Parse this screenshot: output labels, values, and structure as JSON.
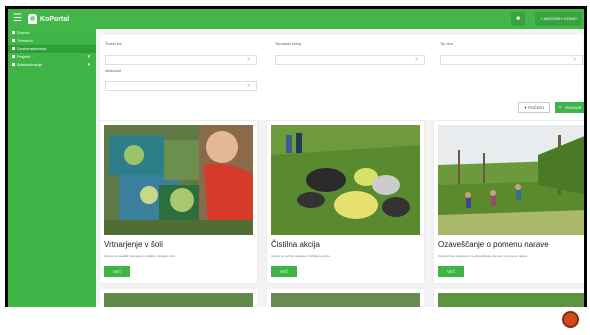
{
  "header": {
    "menu_icon": "hamburger-icon",
    "logo_text": "KoPortal",
    "notification_icon": "bell-icon",
    "user_label": "+ ANDORIH OZIANI"
  },
  "sidebar": {
    "items": [
      {
        "label": "Domov",
        "active": false
      },
      {
        "label": "Trenutno",
        "active": false
      },
      {
        "label": "Dostlansteivnost",
        "active": true
      },
      {
        "label": "Projekti",
        "active": false
      },
      {
        "label": "Administracija",
        "active": false
      }
    ]
  },
  "filters": {
    "labels": [
      "Šolski tim",
      "Tematski sklop",
      "Tip vira",
      "Aktivnost"
    ],
    "clear_label": "✦ POČISTI",
    "search_label": "🔍 ISKANJE"
  },
  "cards": [
    {
      "title": "Vrtnarjenje v šoli",
      "desc": "Učenci so zasadili zelenjavo in zelišča v šolskem vrtu.",
      "button": "VEČ"
    },
    {
      "title": "Čistilna akcija",
      "desc": "Učenci so pobrali odpadke v bližnjem gozdu.",
      "button": "VEČ"
    },
    {
      "title": "Ozaveščanje o pomenu narave",
      "desc": "Organizirane dejavnosti za ozaveščanje učencev o pomenu narave.",
      "button": "VEČ"
    }
  ],
  "colors": {
    "accent": "#43b649",
    "sidebar": "#3fb548",
    "fab": "#d04a1d"
  }
}
